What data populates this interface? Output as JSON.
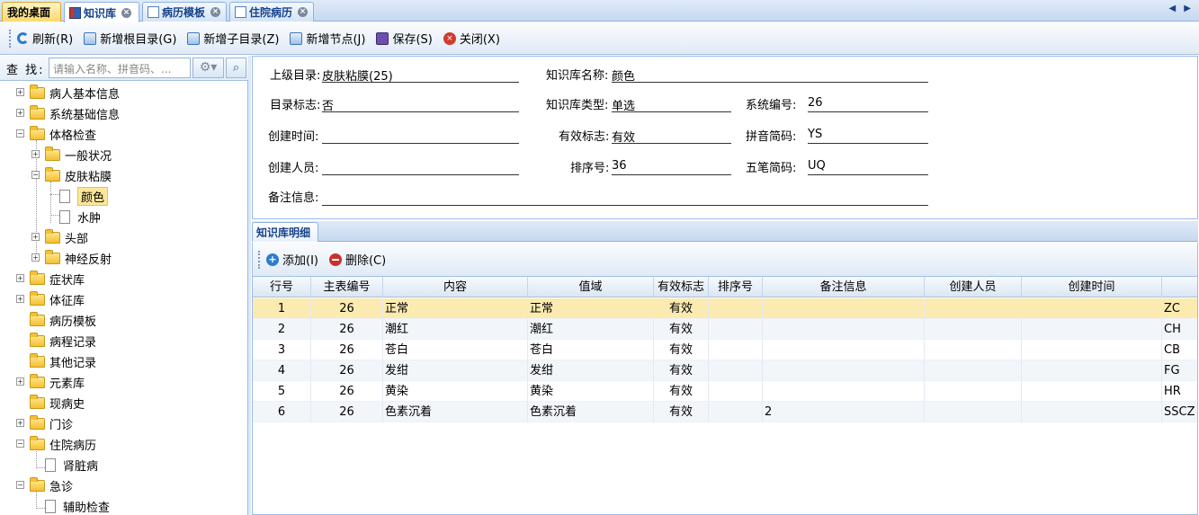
{
  "tabs": [
    {
      "label": "我的桌面",
      "closable": false
    },
    {
      "label": "知识库",
      "closable": true
    },
    {
      "label": "病历模板",
      "closable": true
    },
    {
      "label": "住院病历",
      "closable": true
    }
  ],
  "tab_nav": "◀ ▶",
  "toolbar": {
    "refresh": "刷新(R)",
    "add_root": "新增根目录(G)",
    "add_child": "新增子目录(Z)",
    "add_node": "新增节点(J)",
    "save": "保存(S)",
    "close": "关闭(X)"
  },
  "search": {
    "label": "查 找:",
    "placeholder": "请输入名称、拼音码、..."
  },
  "tree": {
    "n1": "病人基本信息",
    "n2": "系统基础信息",
    "n3": "体格检查",
    "n3a": "一般状况",
    "n3b": "皮肤粘膜",
    "n3b1": "颜色",
    "n3b2": "水肿",
    "n3c": "头部",
    "n3d": "神经反射",
    "n4": "症状库",
    "n5": "体征库",
    "n6": "病历模板",
    "n7": "病程记录",
    "n8": "其他记录",
    "n9": "元素库",
    "n10": "现病史",
    "n11": "门诊",
    "n12": "住院病历",
    "n12a": "肾脏病",
    "n13": "急诊",
    "n13a": "辅助检查"
  },
  "form": {
    "parent_label": "上级目录:",
    "parent_value": "皮肤粘膜(25)",
    "name_label": "知识库名称:",
    "name_value": "颜色",
    "dir_flag_label": "目录标志:",
    "dir_flag_value": "否",
    "kb_type_label": "知识库类型:",
    "kb_type_value": "单选",
    "sys_no_label": "系统编号:",
    "sys_no_value": "26",
    "created_time_label": "创建时间:",
    "created_time_value": "",
    "valid_label": "有效标志:",
    "valid_value": "有效",
    "pinyin_label": "拼音简码:",
    "pinyin_value": "YS",
    "creator_label": "创建人员:",
    "creator_value": "",
    "order_label": "排序号:",
    "order_value": "36",
    "wubi_label": "五笔简码:",
    "wubi_value": "UQ",
    "note_label": "备注信息:",
    "note_value": ""
  },
  "detail": {
    "tab_label": "知识库明细",
    "add": "添加(I)",
    "delete": "删除(C)",
    "headers": [
      "行号",
      "主表编号",
      "内容",
      "值域",
      "有效标志",
      "排序号",
      "备注信息",
      "创建人员",
      "创建时间",
      ""
    ],
    "rows": [
      {
        "no": "1",
        "master": "26",
        "content": "正常",
        "domain": "正常",
        "valid": "有效",
        "order": "",
        "note": "",
        "creator": "",
        "time": "",
        "code": "ZC"
      },
      {
        "no": "2",
        "master": "26",
        "content": "潮红",
        "domain": "潮红",
        "valid": "有效",
        "order": "",
        "note": "",
        "creator": "",
        "time": "",
        "code": "CH"
      },
      {
        "no": "3",
        "master": "26",
        "content": "苍白",
        "domain": "苍白",
        "valid": "有效",
        "order": "",
        "note": "",
        "creator": "",
        "time": "",
        "code": "CB"
      },
      {
        "no": "4",
        "master": "26",
        "content": "发绀",
        "domain": "发绀",
        "valid": "有效",
        "order": "",
        "note": "",
        "creator": "",
        "time": "",
        "code": "FG"
      },
      {
        "no": "5",
        "master": "26",
        "content": "黄染",
        "domain": "黄染",
        "valid": "有效",
        "order": "",
        "note": "",
        "creator": "",
        "time": "",
        "code": "HR"
      },
      {
        "no": "6",
        "master": "26",
        "content": "色素沉着",
        "domain": "色素沉着",
        "valid": "有效",
        "order": "",
        "note": "2",
        "creator": "",
        "time": "",
        "code": "SSCZ"
      }
    ]
  }
}
